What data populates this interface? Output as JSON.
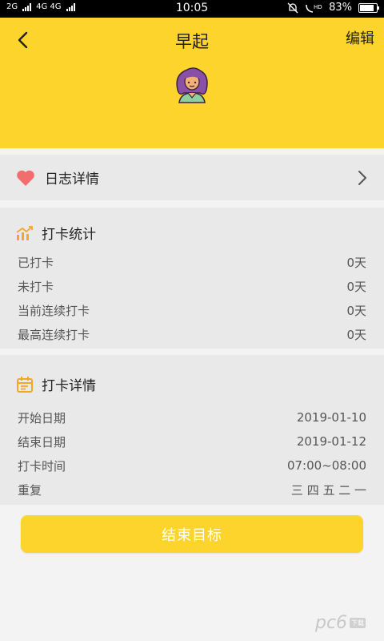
{
  "status_bar": {
    "network_left": "2G",
    "network_right": "4G 4G",
    "time": "10:05",
    "battery": "83%",
    "battery_level": 0.83
  },
  "header": {
    "title": "早起",
    "edit_label": "编辑",
    "accent_color": "#fdd42b"
  },
  "log_detail": {
    "label": "日志详情"
  },
  "stats": {
    "title": "打卡统计",
    "rows": [
      {
        "label": "已打卡",
        "value": "0天"
      },
      {
        "label": "未打卡",
        "value": "0天"
      },
      {
        "label": "当前连续打卡",
        "value": "0天"
      },
      {
        "label": "最高连续打卡",
        "value": "0天"
      }
    ]
  },
  "details": {
    "title": "打卡详情",
    "rows": [
      {
        "label": "开始日期",
        "value": "2019-01-10"
      },
      {
        "label": "结束日期",
        "value": "2019-01-12"
      },
      {
        "label": "打卡时间",
        "value": "07:00~08:00"
      },
      {
        "label": "重复",
        "value": "三 四 五 二 一"
      }
    ]
  },
  "end_button": {
    "label": "结束目标"
  },
  "watermark": {
    "text": "pc6",
    "tag": "下载"
  },
  "icons": {
    "back": "back-arrow-icon",
    "heart": "heart-icon",
    "chevron": "chevron-right-icon",
    "stats": "bar-chart-icon",
    "details": "calendar-icon"
  }
}
